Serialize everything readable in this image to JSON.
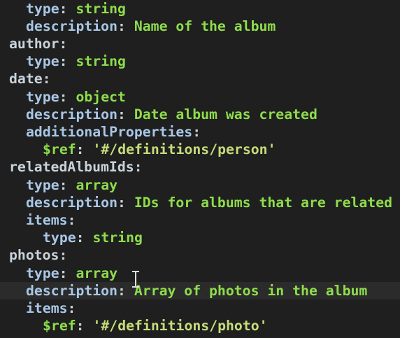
{
  "editor": {
    "current_line": 16,
    "lines": [
      {
        "indent": 2,
        "key": "type",
        "value": "string",
        "vtype": "v"
      },
      {
        "indent": 2,
        "key": "description",
        "value": "Name of the album",
        "vtype": "v"
      },
      {
        "indent": 0,
        "key": "author",
        "value": "",
        "vtype": "v"
      },
      {
        "indent": 2,
        "key": "type",
        "value": "string",
        "vtype": "v"
      },
      {
        "indent": 0,
        "key": "date",
        "value": "",
        "vtype": "v"
      },
      {
        "indent": 2,
        "key": "type",
        "value": "object",
        "vtype": "v"
      },
      {
        "indent": 2,
        "key": "description",
        "value": "Date album was created",
        "vtype": "v"
      },
      {
        "indent": 2,
        "key": "additionalProperties",
        "value": "",
        "vtype": "v"
      },
      {
        "indent": 4,
        "key": "$ref",
        "value": "'#/definitions/person'",
        "vtype": "s"
      },
      {
        "indent": 0,
        "key": "relatedAlbumIds",
        "value": "",
        "vtype": "v"
      },
      {
        "indent": 2,
        "key": "type",
        "value": "array",
        "vtype": "v"
      },
      {
        "indent": 2,
        "key": "description",
        "value": "IDs for albums that are related",
        "vtype": "v"
      },
      {
        "indent": 2,
        "key": "items",
        "value": "",
        "vtype": "v"
      },
      {
        "indent": 4,
        "key": "type",
        "value": "string",
        "vtype": "v"
      },
      {
        "indent": 0,
        "key": "photos",
        "value": "",
        "vtype": "v"
      },
      {
        "indent": 2,
        "key": "type",
        "value": "array",
        "vtype": "v"
      },
      {
        "indent": 2,
        "key": "description",
        "value": "Array of photos in the album",
        "vtype": "v"
      },
      {
        "indent": 2,
        "key": "items",
        "value": "",
        "vtype": "v"
      },
      {
        "indent": 4,
        "key": "$ref",
        "value": "'#/definitions/photo'",
        "vtype": "s"
      }
    ]
  }
}
